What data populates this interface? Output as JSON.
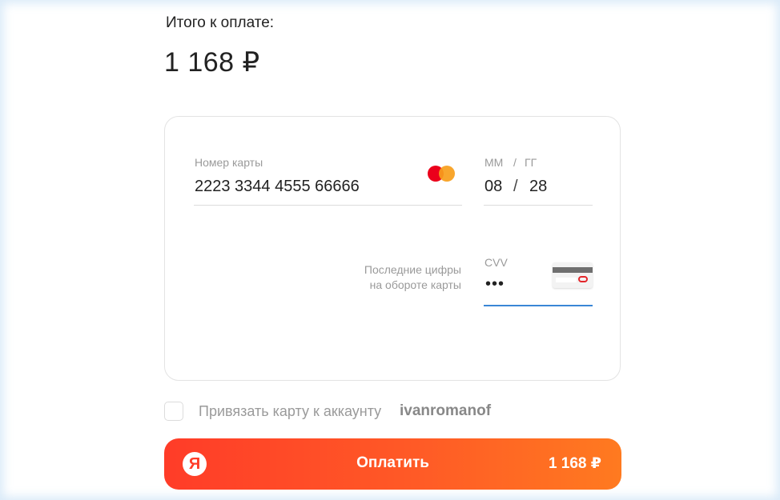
{
  "header": {
    "title": "Итого к оплате:",
    "amount": "1 168 ₽"
  },
  "card_form": {
    "card_number": {
      "label": "Номер карты",
      "value": "2223 3344 4555 66666",
      "brand_icon": "mastercard-icon"
    },
    "expiry": {
      "label_month": "ММ",
      "label_sep": "/",
      "label_year": "ГГ",
      "month": "08",
      "separator": "/",
      "year": "28"
    },
    "cvv": {
      "hint_line1": "Последние цифры",
      "hint_line2": "на обороте карты",
      "label": "CVV",
      "value": "•••",
      "icon": "card-back-cvv-icon"
    }
  },
  "bind_card": {
    "label": "Привязать карту к аккаунту",
    "username": "ivanromanof",
    "checked": false
  },
  "pay_button": {
    "logo": "Я",
    "label": "Оплатить",
    "amount": "1 168 ₽",
    "colors": [
      "#ff3c28",
      "#ff7a20"
    ]
  },
  "colors": {
    "accent_underline": "#3a86d6",
    "mastercard_red": "#eb001b",
    "mastercard_orange": "#f79e1b"
  }
}
